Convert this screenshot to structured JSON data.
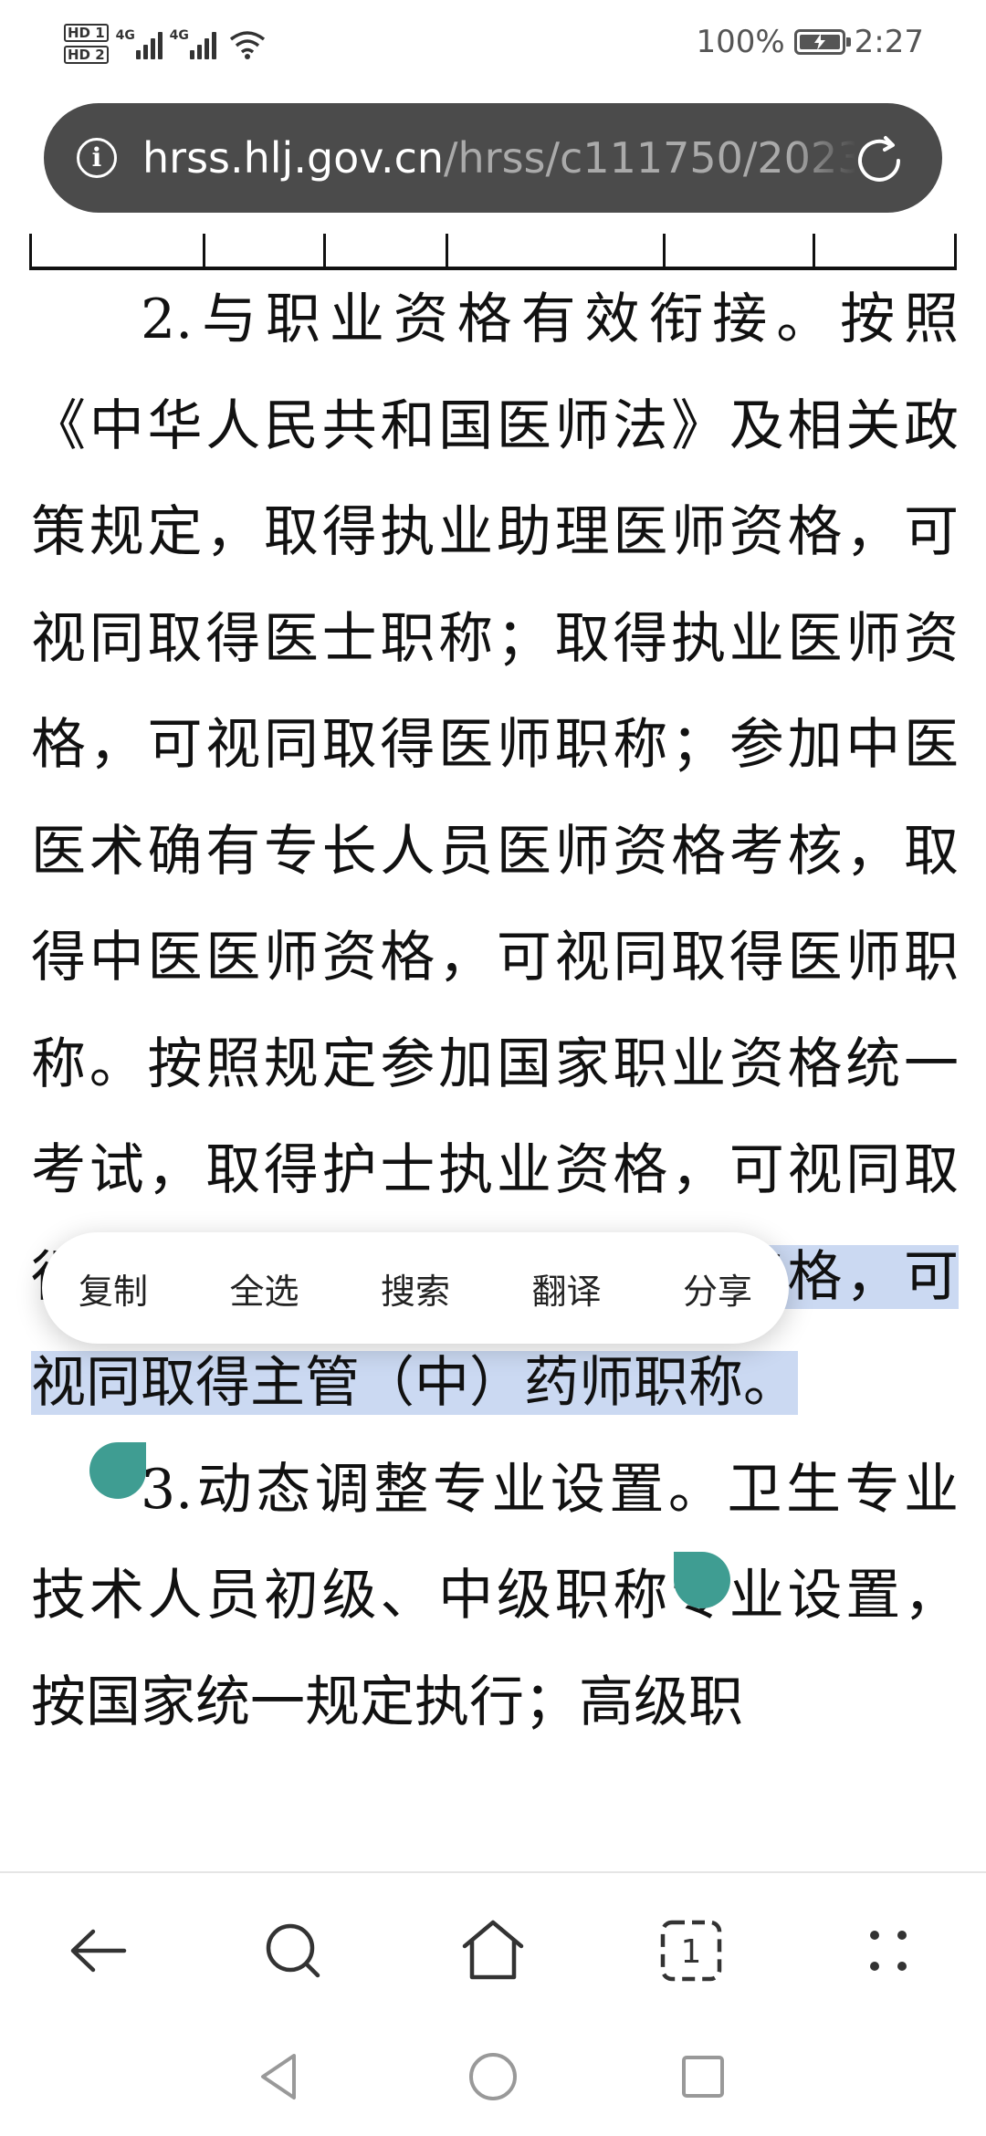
{
  "status_bar": {
    "sim1": "HD 1",
    "sim2": "HD 2",
    "network1": "4G",
    "network2": "4G",
    "battery": "100%",
    "time": "2:27"
  },
  "url_bar": {
    "domain": "hrss.hlj.gov.cn",
    "path": "/hrss/c111750/2023"
  },
  "article": {
    "p1_text": "2.与职业资格有效衔接。按照《中华人民共和国医师法》及相关政策规定，取得执业助理医师资格，可视同取得医士职称；取得执业医师资格，可视同取得医师职称；参加中医医术确有专长人员医师资格考核，取得中医医师资格，可视同取得医师职称。按照规定参加国家职业资格统一考试，取得护士执业资格，可视同取得护士职称；",
    "p1_selected": "取得执业药师资格，可视同取得主管（中）药师职称。",
    "p2_text": "3.动态调整专业设置。卫生专业技术人员初级、中级职称专业设置，按国家统一规定执行；高级职"
  },
  "context_menu": {
    "items": [
      "复制",
      "全选",
      "搜索",
      "翻译",
      "分享"
    ]
  }
}
